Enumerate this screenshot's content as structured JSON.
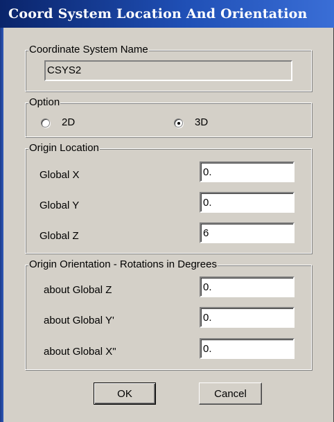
{
  "window": {
    "title": "Coord System Location And Orientation"
  },
  "coordinate_system_name": {
    "legend": "Coordinate System Name",
    "value": "CSYS2"
  },
  "option": {
    "legend": "Option",
    "choices": [
      {
        "label": "2D",
        "selected": false
      },
      {
        "label": "3D",
        "selected": true
      }
    ]
  },
  "origin_location": {
    "legend": "Origin Location",
    "fields": [
      {
        "label": "Global X",
        "value": "0."
      },
      {
        "label": "Global Y",
        "value": "0."
      },
      {
        "label": "Global Z",
        "value": "6"
      }
    ]
  },
  "origin_orientation": {
    "legend": "Origin Orientation - Rotations in Degrees",
    "fields": [
      {
        "label": "about  Global Z",
        "value": "0."
      },
      {
        "label": "about  Global Y'",
        "value": "0."
      },
      {
        "label": "about  Global X\"",
        "value": "0."
      }
    ]
  },
  "buttons": {
    "ok": "OK",
    "cancel": "Cancel"
  }
}
